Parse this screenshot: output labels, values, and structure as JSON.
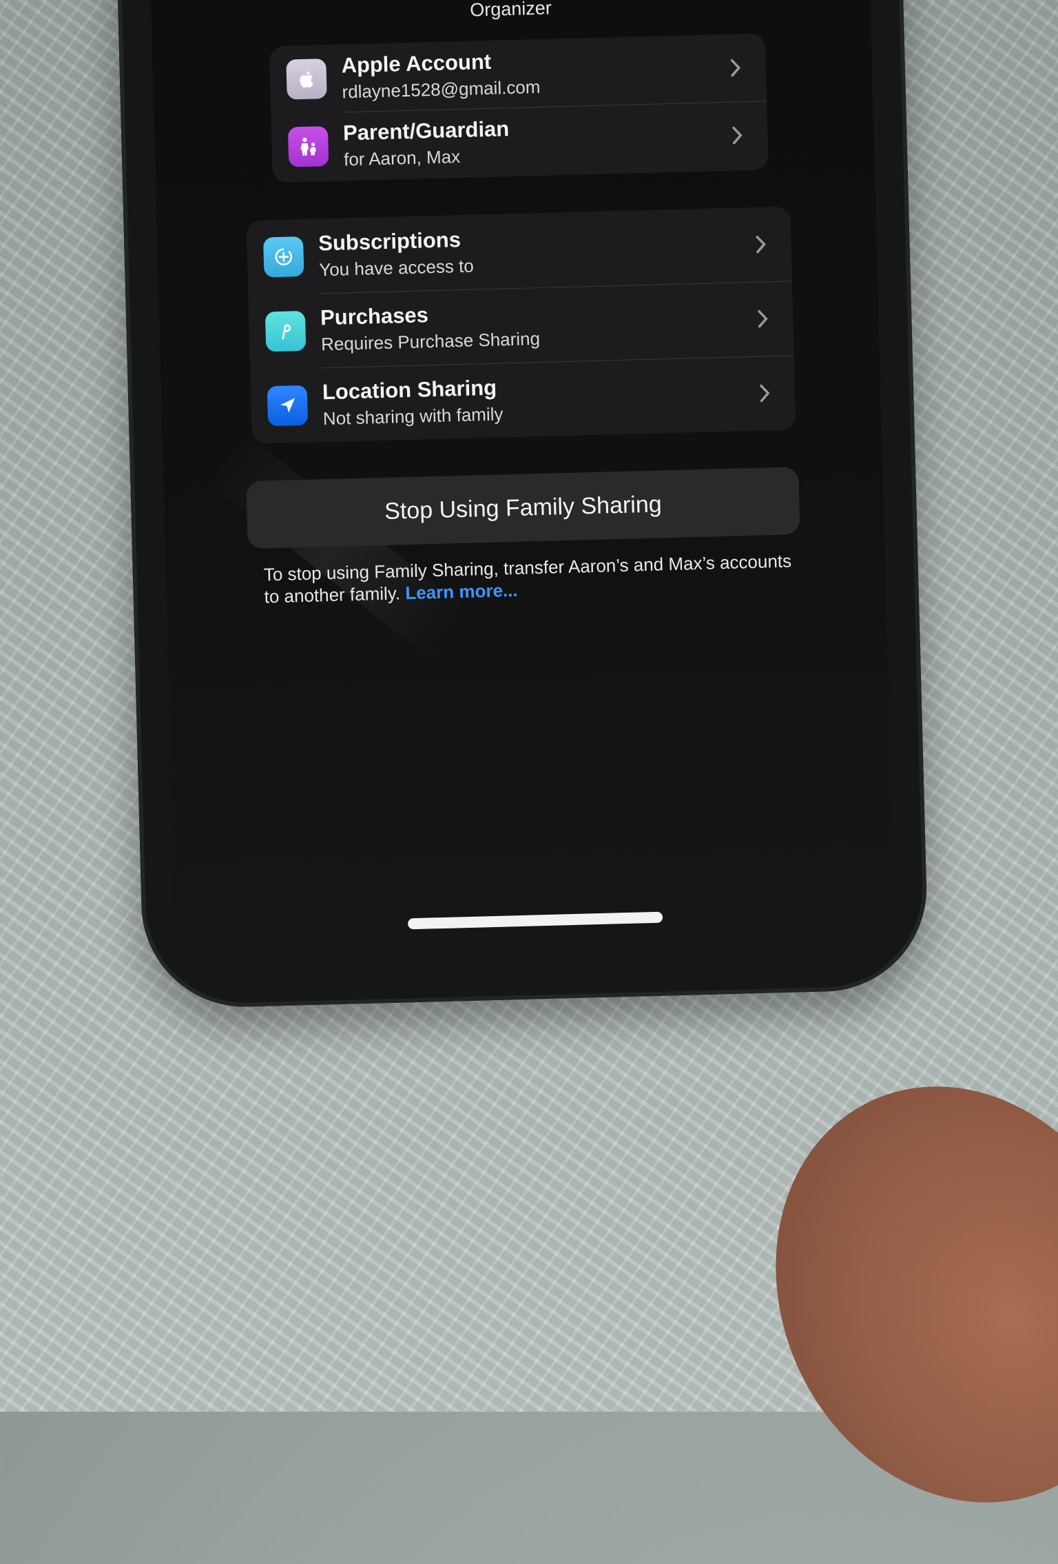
{
  "header": {
    "title": "Organizer"
  },
  "account_group": {
    "items": [
      {
        "icon": "apple-logo-icon",
        "title": "Apple Account",
        "subtitle": "rdlayne1528@gmail.com"
      },
      {
        "icon": "family-parent-icon",
        "title": "Parent/Guardian",
        "subtitle": "for Aaron, Max"
      }
    ]
  },
  "sharing_group": {
    "items": [
      {
        "icon": "subscriptions-icon",
        "title": "Subscriptions",
        "subtitle": "You have access to"
      },
      {
        "icon": "purchases-icon",
        "title": "Purchases",
        "subtitle": "Requires Purchase Sharing"
      },
      {
        "icon": "location-arrow-icon",
        "title": "Location Sharing",
        "subtitle": "Not sharing with family"
      }
    ]
  },
  "stop_button": {
    "label": "Stop Using Family Sharing"
  },
  "footnote": {
    "text": "To stop using Family Sharing, transfer Aaron’s and Max’s accounts to another family.",
    "link": "Learn more..."
  },
  "colors": {
    "link_blue": "#3e95ff",
    "location_icon_blue": "#0a60e0",
    "parent_icon_purple": "#a233d1",
    "subscriptions_icon_blue": "#34aadc",
    "purchases_icon_teal": "#36c3d6"
  }
}
